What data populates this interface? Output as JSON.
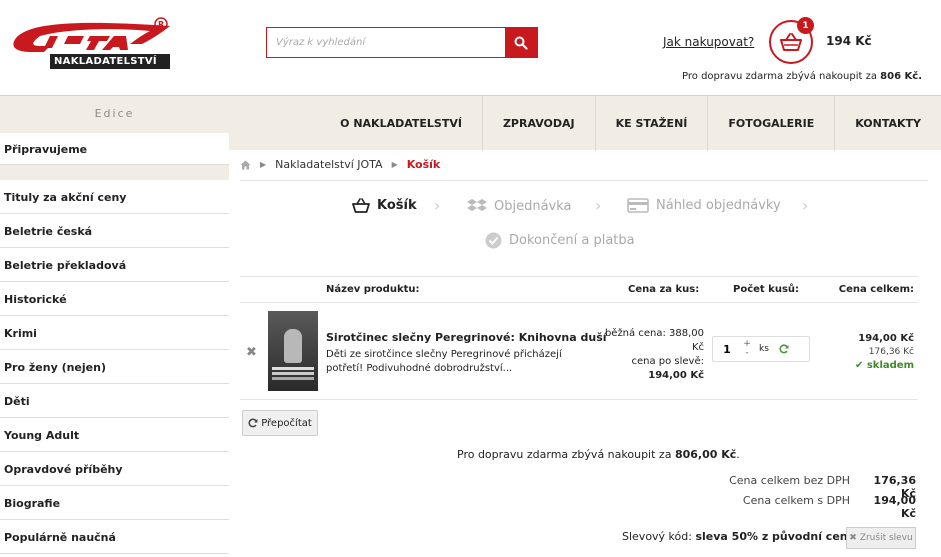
{
  "header": {
    "logo_text": "JOTA",
    "logo_sub": "NAKLADATELSTVÍ",
    "search_placeholder": "Výraz k vyhledání",
    "howto_label": "Jak nakupovat?",
    "cart_count": "1",
    "cart_total": "194 Kč",
    "free_ship_prefix": "Pro dopravu zdarma zbývá nakoupit za",
    "free_ship_amount": "806 Kč."
  },
  "sidebar": {
    "heading": "Edice",
    "first_item": "Připravujeme",
    "items": [
      {
        "label": "Tituly za akční ceny"
      },
      {
        "label": "Beletrie česká"
      },
      {
        "label": "Beletrie překladová"
      },
      {
        "label": "Historické"
      },
      {
        "label": "Krimi"
      },
      {
        "label": "Pro ženy (nejen)"
      },
      {
        "label": "Děti"
      },
      {
        "label": "Young Adult"
      },
      {
        "label": "Opravdové příběhy"
      },
      {
        "label": "Biografie"
      },
      {
        "label": "Populárně naučná"
      }
    ]
  },
  "nav": {
    "items": [
      {
        "label": "O NAKLADATELSTVÍ"
      },
      {
        "label": "ZPRAVODAJ"
      },
      {
        "label": "KE STAŽENÍ"
      },
      {
        "label": "FOTOGALERIE"
      },
      {
        "label": "KONTAKTY"
      }
    ]
  },
  "breadcrumb": {
    "parent": "Nakladatelství JOTA",
    "current": "Košík"
  },
  "steps": {
    "cart": "Košík",
    "order": "Objednávka",
    "preview": "Náhled objednávky",
    "finish": "Dokončení a platba"
  },
  "table": {
    "headers": {
      "name": "Název produktu:",
      "price_unit": "Cena za kus:",
      "quantity": "Počet kusů:",
      "price_total": "Cena celkem:"
    },
    "product": {
      "name": "Sirotčinec slečny Peregrinové: Knihovna duší",
      "description": "Děti ze sirotčince slečny Peregrinové přicházejí potřetí! Podivuhodné dobrodružství...",
      "regular_price_label": "běžná cena: 388,00 Kč",
      "discount_price_label": "cena po slevě:",
      "discount_price": "194,00 Kč",
      "quantity": "1",
      "unit": "ks",
      "total": "194,00 Kč",
      "total_without_vat": "176,36 Kč",
      "stock": "skladem"
    }
  },
  "recalc_label": "Přepočítat",
  "summary": {
    "free_ship_prefix": "Pro dopravu zdarma zbývá nakoupit za",
    "free_ship_amount": "806,00 Kč",
    "without_vat_label": "Cena celkem bez DPH",
    "without_vat_value": "176,36 Kč",
    "with_vat_label": "Cena celkem s DPH",
    "with_vat_value": "194,00 Kč",
    "discount_label": "Slevový kód:",
    "discount_value": "sleva 50% z původní ceny",
    "cancel_discount_label": "Zrušit slevu"
  },
  "colors": {
    "brand_red": "#c8191f",
    "beige": "#f1ede4",
    "stock_green": "#3f8a2a"
  }
}
